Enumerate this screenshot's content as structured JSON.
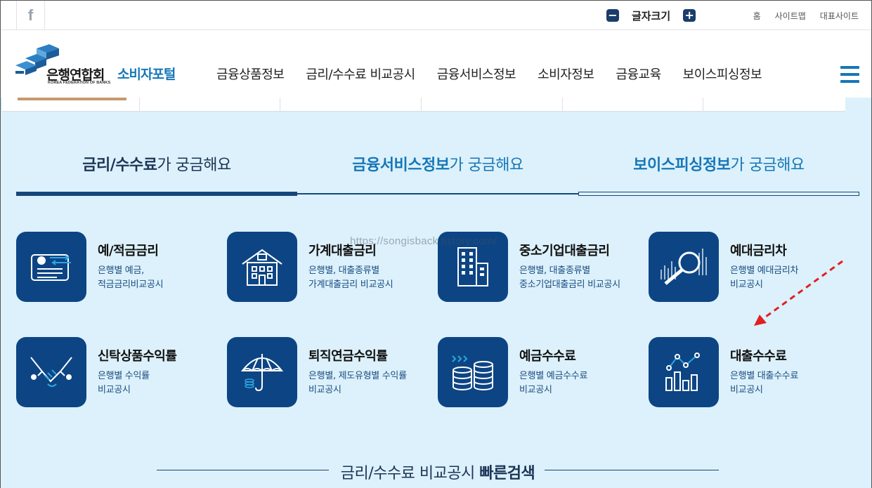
{
  "topbar": {
    "facebook_label": "f",
    "font_size": {
      "minus": "−",
      "label": "글자크기",
      "plus": "+"
    },
    "links": [
      "홈",
      "사이트맵",
      "대표사이트"
    ]
  },
  "header": {
    "logo_ko": "은행연합회",
    "logo_en": "KOREA FEDERATION OF BANKS",
    "portal": "소비자포털",
    "nav": [
      "금융상품정보",
      "금리/수수료 비교공시",
      "금융서비스정보",
      "소비자정보",
      "금융교육",
      "보이스피싱정보"
    ]
  },
  "tabs": [
    {
      "em": "금리/수수료",
      "rest": "가 궁금해요"
    },
    {
      "em": "금융서비스정보",
      "rest": "가 궁금해요"
    },
    {
      "em": "보이스피싱정보",
      "rest": "가 궁금해요"
    }
  ],
  "tiles": [
    {
      "title": "예/적금금리",
      "desc": "은행별 예금,\n적금금리비교공시",
      "icon": "savings-card-icon"
    },
    {
      "title": "가계대출금리",
      "desc": "은행별, 대출종류별\n가계대출금리 비교공시",
      "icon": "house-icon"
    },
    {
      "title": "중소기업대출금리",
      "desc": "은행별, 대출종류별\n중소기업대출금리 비교공시",
      "icon": "building-icon"
    },
    {
      "title": "예대금리차",
      "desc": "은행별 예대금리차\n비교공시",
      "icon": "magnifier-chart-icon"
    },
    {
      "title": "신탁상품수익률",
      "desc": "은행별 수익률\n비교공시",
      "icon": "handshake-icon"
    },
    {
      "title": "퇴직연금수익률",
      "desc": "은행별, 제도유형별 수익률\n비교공시",
      "icon": "umbrella-icon"
    },
    {
      "title": "예금수수료",
      "desc": "은행별 예금수수료\n비교공시",
      "icon": "coins-icon"
    },
    {
      "title": "대출수수료",
      "desc": "은행별 대출수수료\n비교공시",
      "icon": "bar-chart-icon"
    }
  ],
  "watermark": "https://songisback.tistory.com/",
  "quick_search": {
    "rest": "금리/수수료 비교공시 ",
    "em": "빠른검색"
  },
  "colors": {
    "navy": "#0d4584",
    "accent_blue": "#1677b8",
    "bg_light": "#dcf1fb",
    "arrow_red": "#e02020"
  }
}
